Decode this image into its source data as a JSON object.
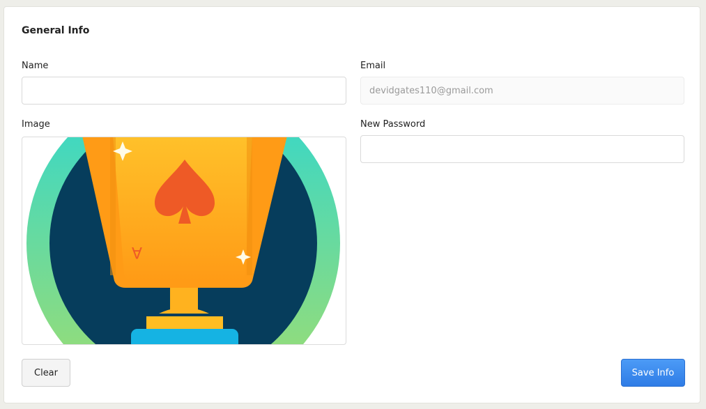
{
  "form": {
    "title": "General Info",
    "name_label": "Name",
    "name_value": "",
    "email_label": "Email",
    "email_placeholder": "devidgates110@gmail.com",
    "image_label": "Image",
    "image_alt": "trophy-card-icon",
    "password_label": "New Password",
    "password_value": ""
  },
  "actions": {
    "clear_label": "Clear",
    "save_label": "Save Info"
  },
  "colors": {
    "save_button": "#3a86f0",
    "ring_top": "#2fd7cf",
    "ring_bottom": "#a2dd6e",
    "circle_fill": "#063d5c",
    "card_fill": "#ffa11a",
    "spade": "#ee5a26"
  }
}
